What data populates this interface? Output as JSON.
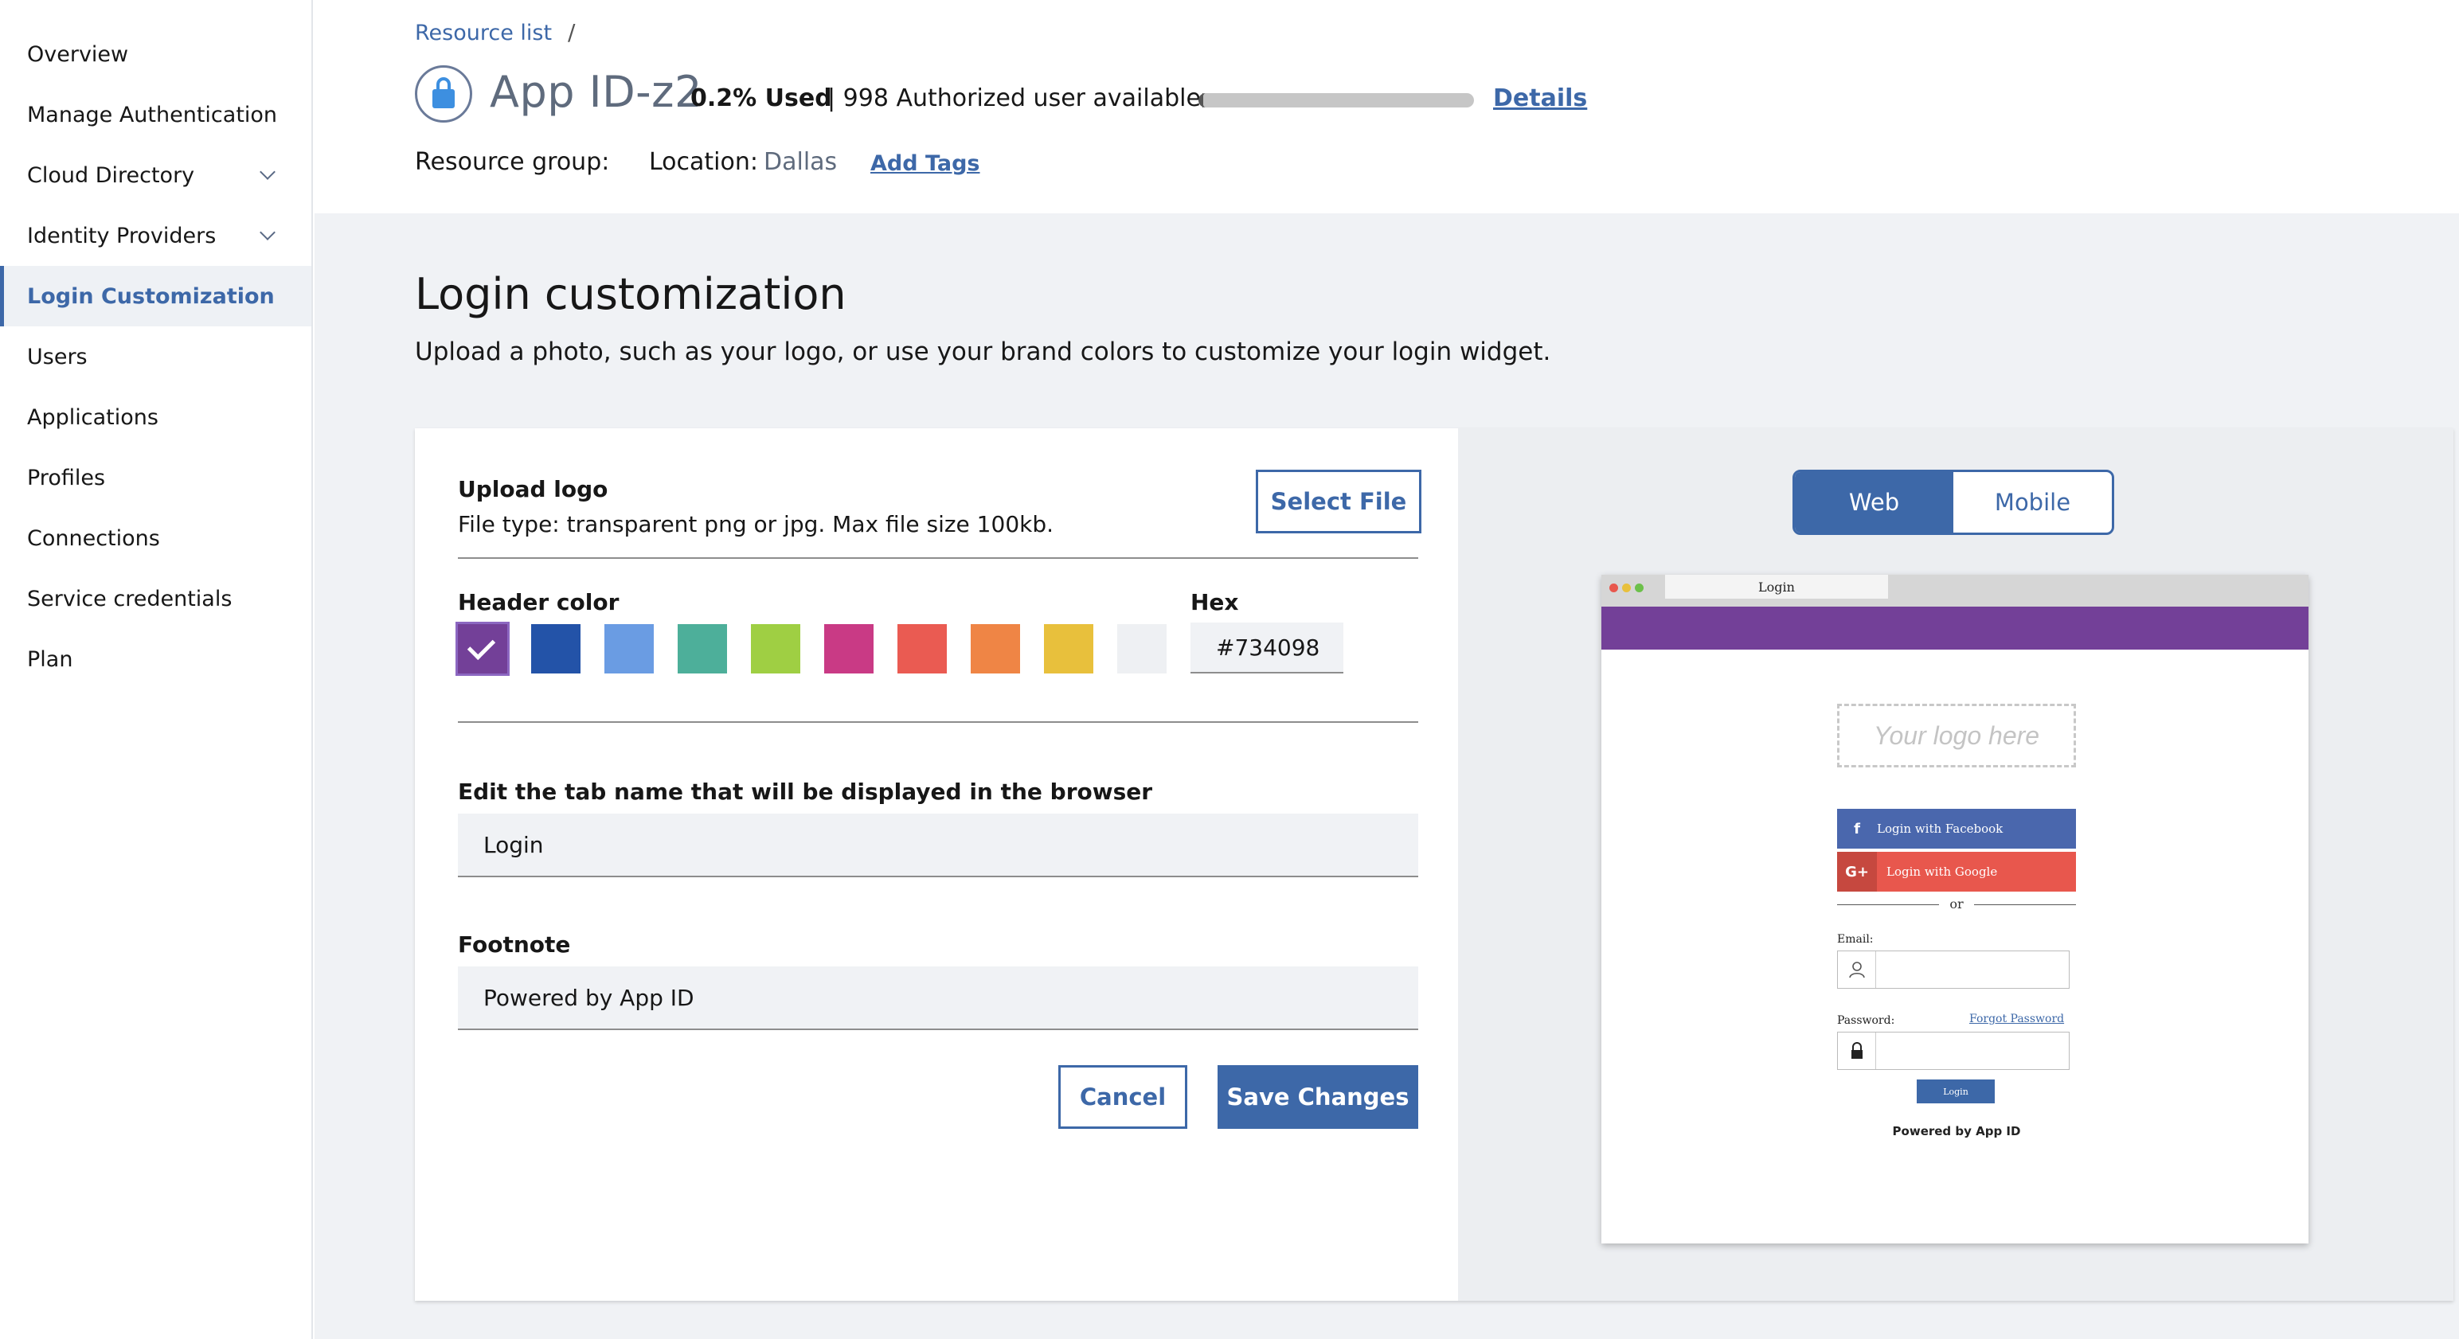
{
  "sidebar": {
    "items": [
      {
        "label": "Overview"
      },
      {
        "label": "Manage Authentication"
      },
      {
        "label": "Cloud Directory"
      },
      {
        "label": "Identity Providers"
      },
      {
        "label": "Login Customization"
      },
      {
        "label": "Users"
      },
      {
        "label": "Applications"
      },
      {
        "label": "Profiles"
      },
      {
        "label": "Connections"
      },
      {
        "label": "Service credentials"
      },
      {
        "label": "Plan"
      }
    ],
    "active_index": 4
  },
  "header": {
    "breadcrumb": "Resource list",
    "breadcrumb_separator": "/",
    "app_title": "App ID-z2",
    "usage_percent_label": "0.2% Used",
    "usage_detail": "| 998 Authorized user available",
    "usage_fraction": 0.002,
    "details_link": "Details",
    "resource_group_label": "Resource group:",
    "location_label": "Location:",
    "location_value": "Dallas",
    "add_tags_link": "Add Tags"
  },
  "main": {
    "title": "Login customization",
    "description": "Upload a photo, such as your logo, or use your brand colors to customize your login widget."
  },
  "form": {
    "upload_logo_title": "Upload logo",
    "upload_logo_help": "File type: transparent png or jpg. Max file size 100kb.",
    "select_file_button": "Select File",
    "header_color_label": "Header color",
    "hex_label": "Hex",
    "hex_value": "#734098",
    "swatches": [
      "#734098",
      "#2353a8",
      "#6a9ce3",
      "#4daf9a",
      "#9fcf43",
      "#c93a85",
      "#ea5b52",
      "#ef8545",
      "#e8c03c",
      "#eef0f3"
    ],
    "selected_swatch": 0,
    "tab_name_label": "Edit the tab name that will be displayed in the browser",
    "tab_name_value": "Login",
    "footnote_label": "Footnote",
    "footnote_value": "Powered by App ID",
    "cancel_button": "Cancel",
    "save_button": "Save Changes"
  },
  "preview": {
    "toggle_web": "Web",
    "toggle_mobile": "Mobile",
    "active_toggle": "Web",
    "browser_tab_title": "Login",
    "header_color": "#734098",
    "logo_placeholder": "Your logo here",
    "facebook_button": "Login with Facebook",
    "facebook_icon": "f",
    "google_button": "Login with Google",
    "google_icon": "G+",
    "or_text": "or",
    "email_label": "Email:",
    "password_label": "Password:",
    "forgot_password": "Forgot Password",
    "login_button": "Login",
    "footnote": "Powered by App ID"
  },
  "colors": {
    "accent": "#3d68a8",
    "facebook": "#4a67ad",
    "google": "#e8574d",
    "google_icon_bg": "#c6483f"
  }
}
